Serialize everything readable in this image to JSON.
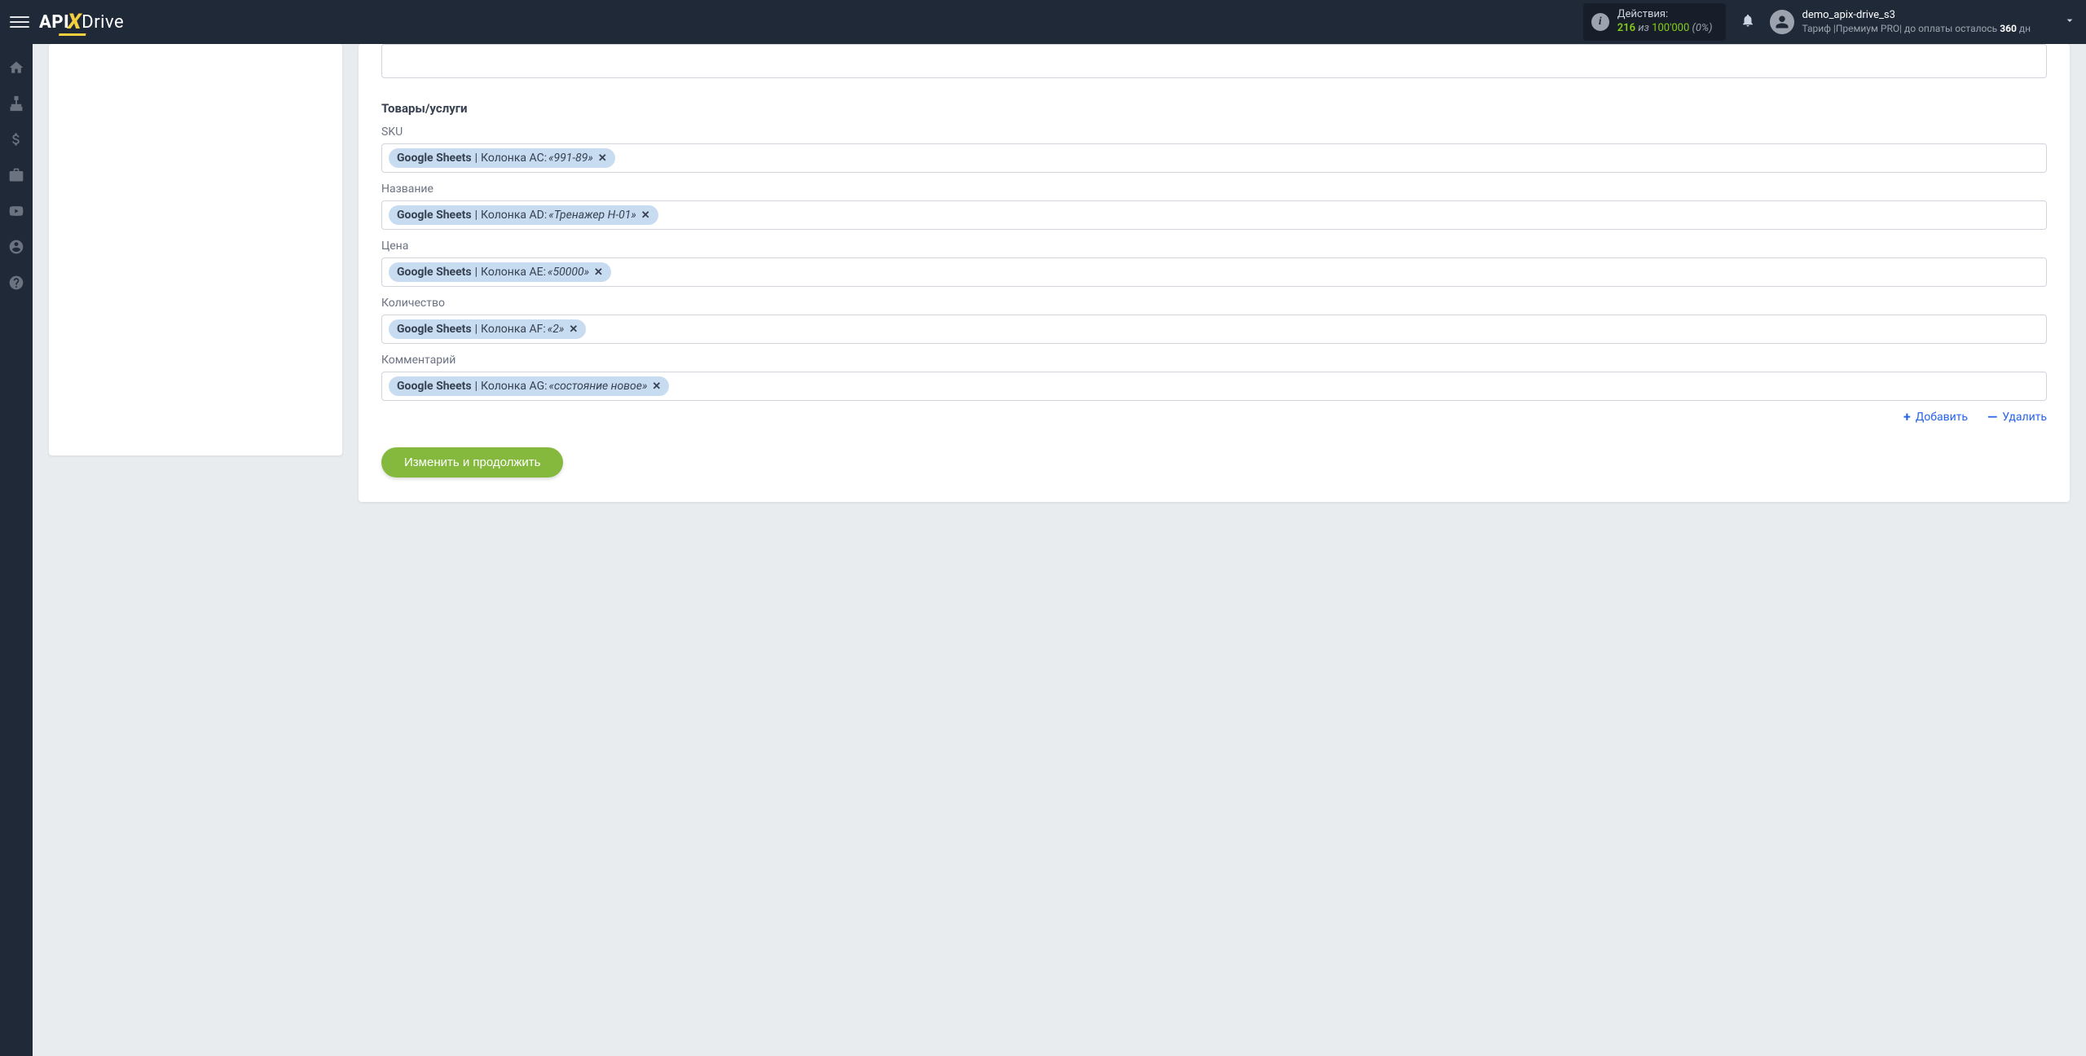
{
  "header": {
    "logo": {
      "api": "API",
      "x": "X",
      "drive": "Drive"
    },
    "actions": {
      "label": "Действия:",
      "count": "216",
      "of": "из",
      "total": "100'000",
      "pct": "(0%)"
    },
    "user": {
      "name": "demo_apix-drive_s3",
      "tariff_prefix": "Тариф |",
      "tariff_name": "Премиум PRO",
      "tariff_suffix": "|  до оплаты осталось",
      "days": "360",
      "days_suffix": "дн"
    }
  },
  "form": {
    "section_title": "Товары/услуги",
    "fields": [
      {
        "label": "SKU",
        "source": "Google Sheets",
        "column": "Колонка AC:",
        "value": "«991-89»"
      },
      {
        "label": "Название",
        "source": "Google Sheets",
        "column": "Колонка AD:",
        "value": "«Тренажер H-01»"
      },
      {
        "label": "Цена",
        "source": "Google Sheets",
        "column": "Колонка AE:",
        "value": "«50000»"
      },
      {
        "label": "Количество",
        "source": "Google Sheets",
        "column": "Колонка AF:",
        "value": "«2»"
      },
      {
        "label": "Комментарий",
        "source": "Google Sheets",
        "column": "Колонка AG:",
        "value": "«состояние новое»"
      }
    ],
    "add": "Добавить",
    "delete": "Удалить",
    "submit": "Изменить и продолжить"
  }
}
